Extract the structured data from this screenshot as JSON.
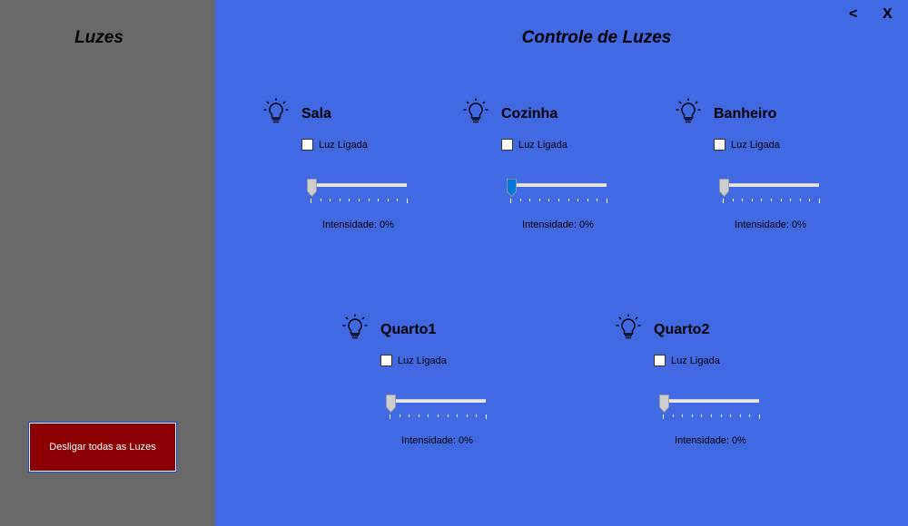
{
  "sidebar": {
    "title": "Luzes",
    "off_all_button": "Desligar todas as Luzes"
  },
  "header": {
    "title": "Controle de Luzes",
    "back_label": "<",
    "close_label": "X"
  },
  "rooms": [
    {
      "name": "Sala",
      "checkbox_label": "Luz Ligada",
      "checked": false,
      "intensity": 0,
      "intensity_label": "Intensidade: 0%",
      "focused": false
    },
    {
      "name": "Cozinha",
      "checkbox_label": "Luz Ligada",
      "checked": false,
      "intensity": 0,
      "intensity_label": "Intensidade: 0%",
      "focused": true
    },
    {
      "name": "Banheiro",
      "checkbox_label": "Luz Ligada",
      "checked": false,
      "intensity": 0,
      "intensity_label": "Intensidade: 0%",
      "focused": false
    },
    {
      "name": "Quarto1",
      "checkbox_label": "Luz Ligada",
      "checked": false,
      "intensity": 0,
      "intensity_label": "Intensidade: 0%",
      "focused": false
    },
    {
      "name": "Quarto2",
      "checkbox_label": "Luz Ligada",
      "checked": false,
      "intensity": 0,
      "intensity_label": "Intensidade: 0%",
      "focused": false
    }
  ],
  "colors": {
    "main_bg": "#4169E1",
    "sidebar_bg": "#696969",
    "button_bg": "#8B0000",
    "thumb_default": "#cdcdcd",
    "thumb_focused": "#0078d7"
  }
}
